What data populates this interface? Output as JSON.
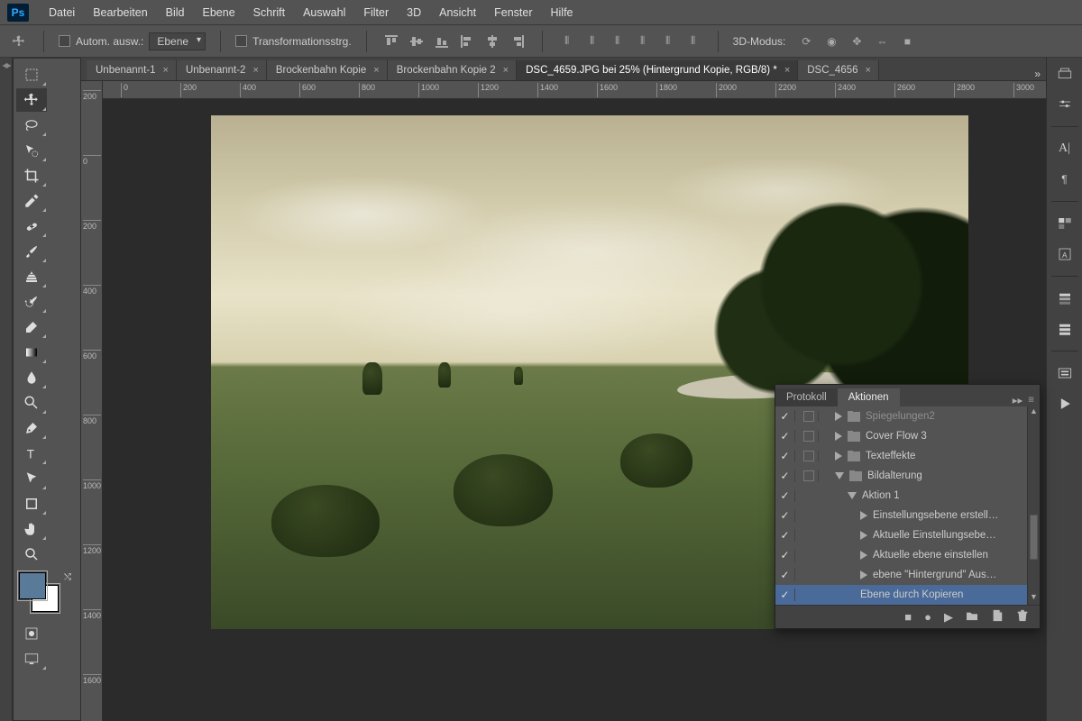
{
  "app": {
    "logo": "Ps"
  },
  "menu": [
    "Datei",
    "Bearbeiten",
    "Bild",
    "Ebene",
    "Schrift",
    "Auswahl",
    "Filter",
    "3D",
    "Ansicht",
    "Fenster",
    "Hilfe"
  ],
  "optbar": {
    "auto_select_label": "Autom. ausw.:",
    "target_dropdown": "Ebene",
    "transform_label": "Transformationsstrg.",
    "mode3d_label": "3D-Modus:"
  },
  "doctabs": [
    {
      "title": "Unbenannt-1",
      "active": false
    },
    {
      "title": "Unbenannt-2",
      "active": false
    },
    {
      "title": "Brockenbahn Kopie",
      "active": false
    },
    {
      "title": "Brockenbahn Kopie 2",
      "active": false
    },
    {
      "title": "DSC_4659.JPG bei 25% (Hintergrund Kopie, RGB/8) *",
      "active": true
    },
    {
      "title": "DSC_4656",
      "active": false
    }
  ],
  "hruler": [
    "0",
    "200",
    "400",
    "600",
    "800",
    "1000",
    "1200",
    "1400",
    "1600",
    "1800",
    "2000",
    "2200",
    "2400",
    "2600",
    "2800",
    "3000"
  ],
  "vruler": [
    "200",
    "0",
    "200",
    "400",
    "600",
    "800",
    "1000",
    "1200",
    "1400",
    "1600"
  ],
  "colors": {
    "foreground": "#5a7a9a",
    "background": "#ffffff"
  },
  "actions_panel": {
    "tabs": [
      "Protokoll",
      "Aktionen"
    ],
    "active_tab": 1,
    "rows": [
      {
        "check": true,
        "mod": true,
        "indent": 1,
        "icon": "folder",
        "label": "Spiegelungen2",
        "disclose": "right",
        "dim": true
      },
      {
        "check": true,
        "mod": true,
        "indent": 1,
        "icon": "folder",
        "label": "Cover Flow 3",
        "disclose": "right"
      },
      {
        "check": true,
        "mod": true,
        "indent": 1,
        "icon": "folder",
        "label": "Texteffekte",
        "disclose": "right"
      },
      {
        "check": true,
        "mod": true,
        "indent": 1,
        "icon": "folder-open",
        "label": "Bildalterung",
        "disclose": "down"
      },
      {
        "check": true,
        "mod": false,
        "indent": 2,
        "icon": "",
        "label": "Aktion 1",
        "disclose": "down"
      },
      {
        "check": true,
        "mod": false,
        "indent": 3,
        "icon": "",
        "label": "Einstellungsebene erstell…",
        "disclose": "right"
      },
      {
        "check": true,
        "mod": false,
        "indent": 3,
        "icon": "",
        "label": "Aktuelle Einstellungsebe…",
        "disclose": "right"
      },
      {
        "check": true,
        "mod": false,
        "indent": 3,
        "icon": "",
        "label": "Aktuelle ebene einstellen",
        "disclose": "right"
      },
      {
        "check": true,
        "mod": false,
        "indent": 3,
        "icon": "",
        "label": "ebene \"Hintergrund\" Aus…",
        "disclose": "right"
      },
      {
        "check": true,
        "mod": false,
        "indent": 3,
        "icon": "",
        "label": "Ebene durch Kopieren",
        "disclose": "",
        "selected": true
      }
    ]
  }
}
